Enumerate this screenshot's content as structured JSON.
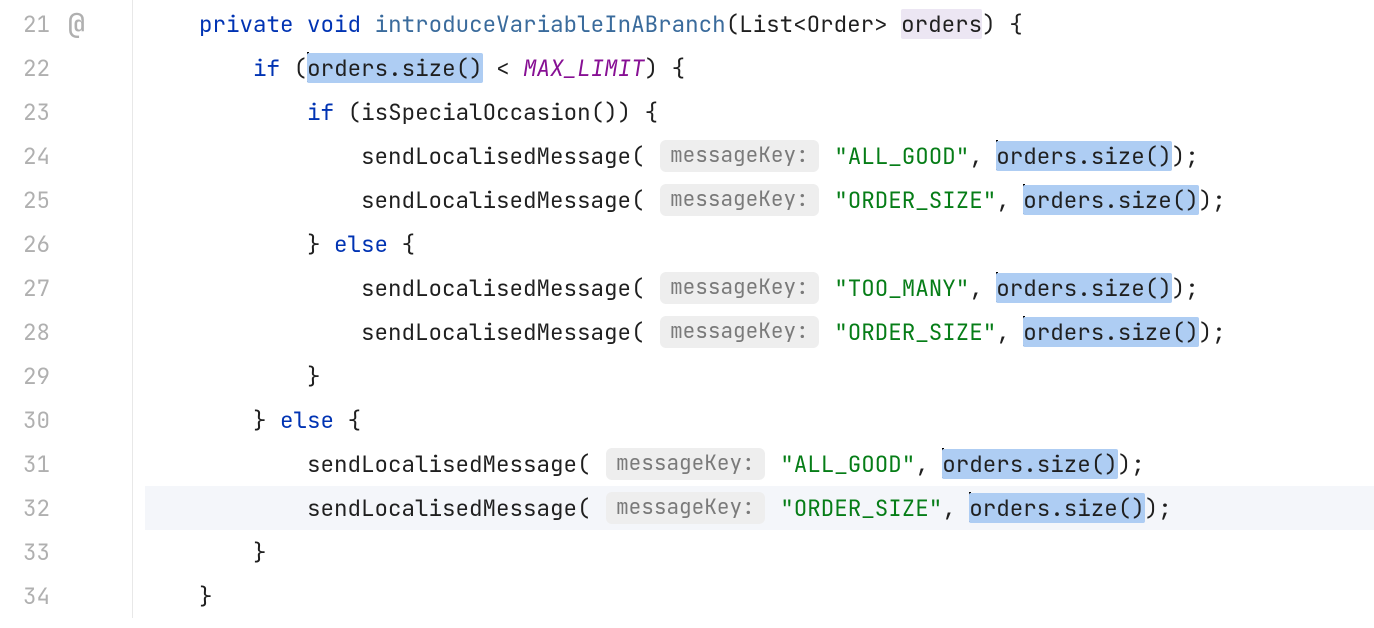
{
  "gutter": {
    "start": 21,
    "end": 34,
    "at_symbol": "@",
    "at_line": 21
  },
  "tokens": {
    "kw_private": "private",
    "kw_void": "void",
    "kw_if": "if",
    "kw_else": "else",
    "method_decl": "introduceVariableInABranch",
    "type_list": "List",
    "type_order": "Order",
    "param_orders": "orders",
    "expr_orders_size": "orders.size()",
    "const_max_limit": "MAX_LIMIT",
    "call_isSpecialOccasion": "isSpecialOccasion()",
    "call_sendLocalisedMessage": "sendLocalisedMessage",
    "hint_messageKey": "messageKey:",
    "str_all_good": "\"ALL_GOOD\"",
    "str_order_size": "\"ORDER_SIZE\"",
    "str_too_many": "\"TOO_MANY\""
  },
  "highlights": {
    "selected_expr": "orders.size()",
    "usage_param": "orders"
  },
  "chart_data": null
}
